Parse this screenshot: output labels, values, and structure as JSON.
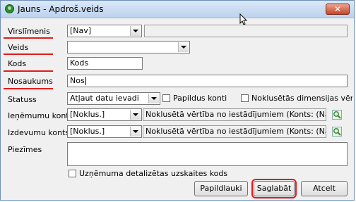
{
  "window": {
    "title": "Jauns - Apdroš.veids",
    "close_label": "✕"
  },
  "form": {
    "virsliminis": {
      "label": "Virslīmenis",
      "value": "[Nav]"
    },
    "veids": {
      "label": "Veids",
      "value": ""
    },
    "kods": {
      "label": "Kods",
      "value": "Kods"
    },
    "nosaukums": {
      "label": "Nosaukums",
      "value": "Nos"
    },
    "statuss": {
      "label": "Statuss",
      "value": "Atļaut datu ievadi"
    },
    "papildus_konti": {
      "label": "Papildus konti"
    },
    "noklusetas_dimensijas": {
      "label": "Noklusētās dimensijas vērtības"
    },
    "ienemumu_konts": {
      "label": "Ieņēmumu konts",
      "value": "[Noklus.]",
      "info": "Noklusētā vērtība no iestādījumiem (Konts: (Nav))"
    },
    "izdevumu_konts": {
      "label": "Izdevumu konts",
      "value": "[Noklus.]",
      "info": "Noklusētā vērtība no iestādījumiem (Konts: (Nav))"
    },
    "piezimes": {
      "label": "Piezīmes",
      "value": ""
    },
    "detalizetas_uzskaites": {
      "label": "Uzņēmuma detalizētas uzskaites kods"
    }
  },
  "buttons": {
    "papildlauki": "Papildlauki",
    "saglabat": "Saglabāt",
    "atcelt": "Atcelt"
  },
  "colors": {
    "highlight": "#e21b1b",
    "title_gradient_top": "#dbe8f7",
    "title_gradient_bottom": "#bcd2ee",
    "lookup_icon": "#3a8a3a"
  },
  "icons": {
    "title": "green-circle-icon",
    "lookup": "magnifier-icon",
    "close": "close-icon"
  }
}
